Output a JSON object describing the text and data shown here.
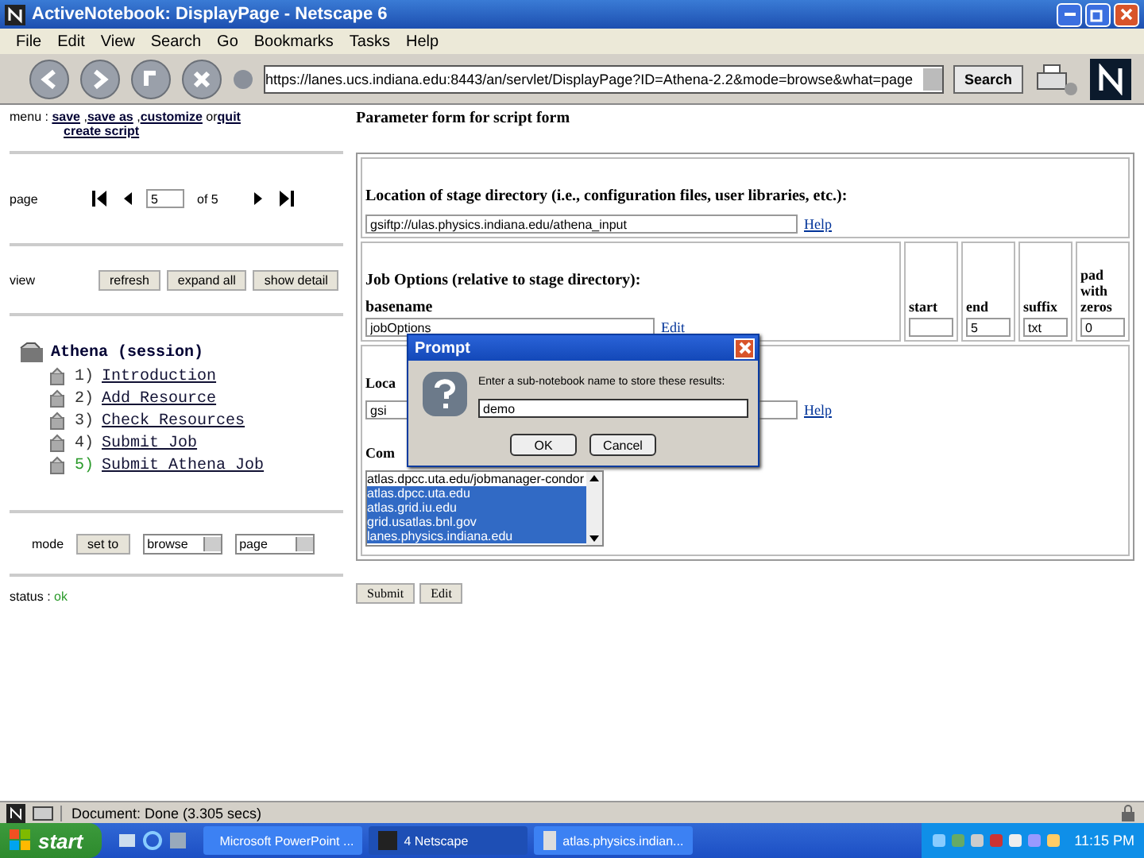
{
  "window": {
    "title": "ActiveNotebook: DisplayPage - Netscape 6"
  },
  "menu": [
    "File",
    "Edit",
    "View",
    "Search",
    "Go",
    "Bookmarks",
    "Tasks",
    "Help"
  ],
  "toolbar": {
    "url": "https://lanes.ucs.indiana.edu:8443/an/servlet/DisplayPage?ID=Athena-2.2&mode=browse&what=page",
    "search": "Search"
  },
  "left": {
    "menu_label": "menu :",
    "menu_links": [
      {
        "text": "save",
        "after": " ,"
      },
      {
        "text": "save as",
        "after": " ,"
      },
      {
        "text": "customize",
        "after": " or"
      },
      {
        "text": "quit"
      }
    ],
    "create": "create script",
    "page_label": "page",
    "page_value": "5",
    "page_of": "of 5",
    "view_label": "view",
    "view_buttons": [
      "refresh",
      "expand all",
      "show detail"
    ],
    "tree": {
      "label": "Athena (session)",
      "children": [
        {
          "num": "1)",
          "label": "Introduction",
          "current": false
        },
        {
          "num": "2)",
          "label": "Add Resource",
          "current": false
        },
        {
          "num": "3)",
          "label": "Check Resources",
          "current": false
        },
        {
          "num": "4)",
          "label": "Submit Job",
          "current": false
        },
        {
          "num": "5)",
          "label": "Submit Athena Job",
          "current": true
        }
      ]
    },
    "mode_label": "mode",
    "mode_button": "set to",
    "mode_selects": [
      "browse",
      "page"
    ],
    "status_label": "status :",
    "status_value": "ok"
  },
  "form": {
    "title": "Parameter form for script form",
    "stage_label": "Location of stage directory (i.e., configuration files, user libraries, etc.):",
    "stage_value": "gsiftp://ulas.physics.indiana.edu/athena_input",
    "help": "Help",
    "job_label": "Job Options (relative to stage directory):",
    "basename_label": "basename",
    "basename_value": "jobOptions",
    "edit_link": "Edit",
    "columns": [
      {
        "label": "start"
      },
      {
        "label": "end",
        "value": "5"
      },
      {
        "label": "suffix",
        "value": "txt"
      },
      {
        "label": "pad with zeros",
        "value": "0"
      }
    ],
    "loc_label": "Loca",
    "loc_value": "gsi",
    "help2": "Help",
    "comp_label": "Com",
    "hosts": [
      {
        "text": "atlas.dpcc.uta.edu/jobmanager-condor",
        "selected": false
      },
      {
        "text": "atlas.dpcc.uta.edu",
        "selected": true
      },
      {
        "text": "atlas.grid.iu.edu",
        "selected": true
      },
      {
        "text": "grid.usatlas.bnl.gov",
        "selected": true
      },
      {
        "text": "lanes.physics.indiana.edu",
        "selected": true
      }
    ],
    "buttons": [
      "Submit",
      "Edit"
    ]
  },
  "dialog": {
    "title": "Prompt",
    "message": "Enter a sub-notebook name to store these results:",
    "value": "demo",
    "buttons": [
      "OK",
      "Cancel"
    ]
  },
  "status_bar": "Document: Done (3.305 secs)",
  "taskbar": {
    "start": "start",
    "tasks": [
      "Microsoft PowerPoint ...",
      "4 Netscape",
      "atlas.physics.indian..."
    ],
    "clock": "11:15 PM"
  }
}
